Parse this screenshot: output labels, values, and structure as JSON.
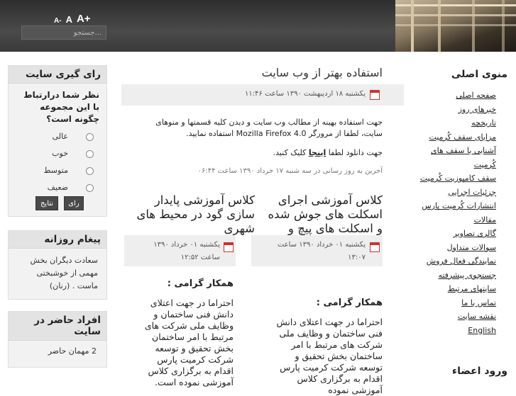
{
  "header": {
    "font_controls": [
      "A-",
      "A",
      "A+"
    ],
    "search_placeholder": "جستجو..."
  },
  "main_menu": {
    "title": "منوی اصلی",
    "items": [
      "صفحه اصلی",
      "خبرهای روز",
      "تاریخچه",
      "مزایای سقف کُرمیت",
      "آشنایی با سقف های کُرمیت",
      "سقف کامپوزیت کُرمیت",
      "جزئیات اجرایی",
      "انتشارات کُرمیت پارس",
      "مقالات",
      "گالری تصاویر",
      "سوالات متداول",
      "نمایندگی فعال فروش",
      "جستجوی پیشرفته",
      "سایتهای مرتبط",
      "تماس با ما",
      "نقشه سایت",
      "English"
    ],
    "login_title": "ورود اعضاء"
  },
  "poll": {
    "title": "رای گیری سایت",
    "question": "نظر شما درارتباط با این مجموعه چگونه است؟",
    "options": [
      "عالی",
      "خوب",
      "متوسط",
      "ضعیف"
    ],
    "vote_button": "رای",
    "results_button": "نتایج"
  },
  "daily_message": {
    "title": "پیغام روزانه",
    "text": "سعادت دیگران بخش مهمی از خوشبختی ماست . (رنان)"
  },
  "online": {
    "title": "افراد حاضر در سایت",
    "text": "2 مهمان حاضر"
  },
  "article": {
    "title": "استفاده بهتر از وب سایت",
    "date": "یکشنبه ۱۸ اردیبهشت ۱۳۹۰ ساعت ۱۱:۴۶",
    "paragraph1": "جهت استفاده بهینه از مطالب وب سایت  و دیدن کلیه قسمتها و منوهای سایت، لطفا از مرورگر  Mozilla Firefox 4.0 استفاده نمایید.",
    "paragraph2_prefix": "جهت دانلود لطفا ",
    "paragraph2_link": "اینجا",
    "paragraph2_suffix": " کلیک کنید.",
    "updated": "آخرین به روز رسانی در سه شنبه ۱۷ خرداد ۱۳۹۰ ساعت ۰۶:۴۴"
  },
  "news": [
    {
      "title": "کلاس آموزشی اجرای اسکلت های جوش شده و اسکلت های پیچ و مهره",
      "date": "یکشنبه ۰۱ خرداد ۱۳۹۰ ساعت ۱۳:۰۷",
      "greeting": "همکار گرامی :",
      "body": "احتراما در جهت اعتلای دانش فنی ساختمان و وظایف ملی شرکت های مرتبط با امر ساختمان بخش تحقیق و توسعه شرکت کرمیت پارس اقدام به برگزاری کلاس آموزشی نموده"
    },
    {
      "title": "کلاس آموزشی پایدار سازی گود در محیط های شهری",
      "date": "یکشنبه ۰۱ خرداد ۱۳۹۰ ساعت ۱۲:۵۲",
      "greeting": "همکار گرامی :",
      "body": "احتراما در جهت اعتلای دانش فنی ساختمان و وظایف ملی شرکت های مرتبط با امر ساختمان بخش تحقیق و توسعه شرکت کرمیت پارس اقدام به برگزاری کلاس آموزشی نموده است."
    }
  ]
}
